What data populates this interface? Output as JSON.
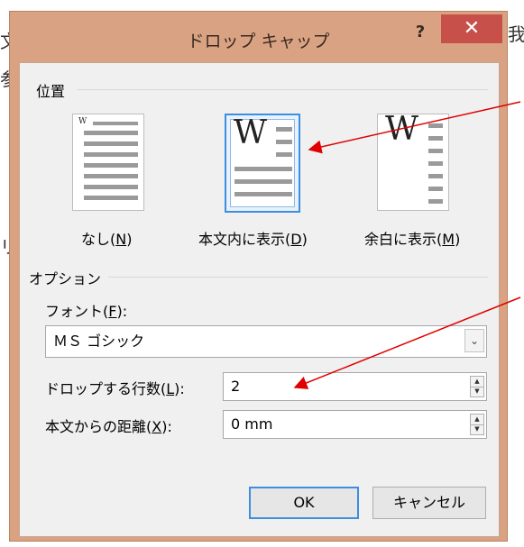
{
  "background": {
    "char_top_right": "我",
    "char_left_1": "文",
    "char_left_2": "参",
    "char_left_3": "リ"
  },
  "dialog": {
    "title": "ドロップ キャップ",
    "help_label": "?",
    "close_label": "✕"
  },
  "position_group": {
    "title": "位置",
    "options": [
      {
        "label_pre": "なし(",
        "key": "N",
        "label_post": ")",
        "selected": false
      },
      {
        "label_pre": "本文内に表示(",
        "key": "D",
        "label_post": ")",
        "selected": true
      },
      {
        "label_pre": "余白に表示(",
        "key": "M",
        "label_post": ")",
        "selected": false
      }
    ],
    "glyph": "W"
  },
  "options_group": {
    "title": "オプション",
    "font": {
      "label_pre": "フォント(",
      "key": "F",
      "label_post": "):",
      "value": "ＭＳ ゴシック"
    },
    "lines": {
      "label_pre": "ドロップする行数(",
      "key": "L",
      "label_post": "):",
      "value": "2"
    },
    "distance": {
      "label_pre": "本文からの距離(",
      "key": "X",
      "label_post": "):",
      "value": "0 mm"
    }
  },
  "buttons": {
    "ok": "OK",
    "cancel": "キャンセル"
  },
  "colors": {
    "accent": "#3d8ee0",
    "annotation": "#e00000",
    "close": "#c7504b"
  }
}
